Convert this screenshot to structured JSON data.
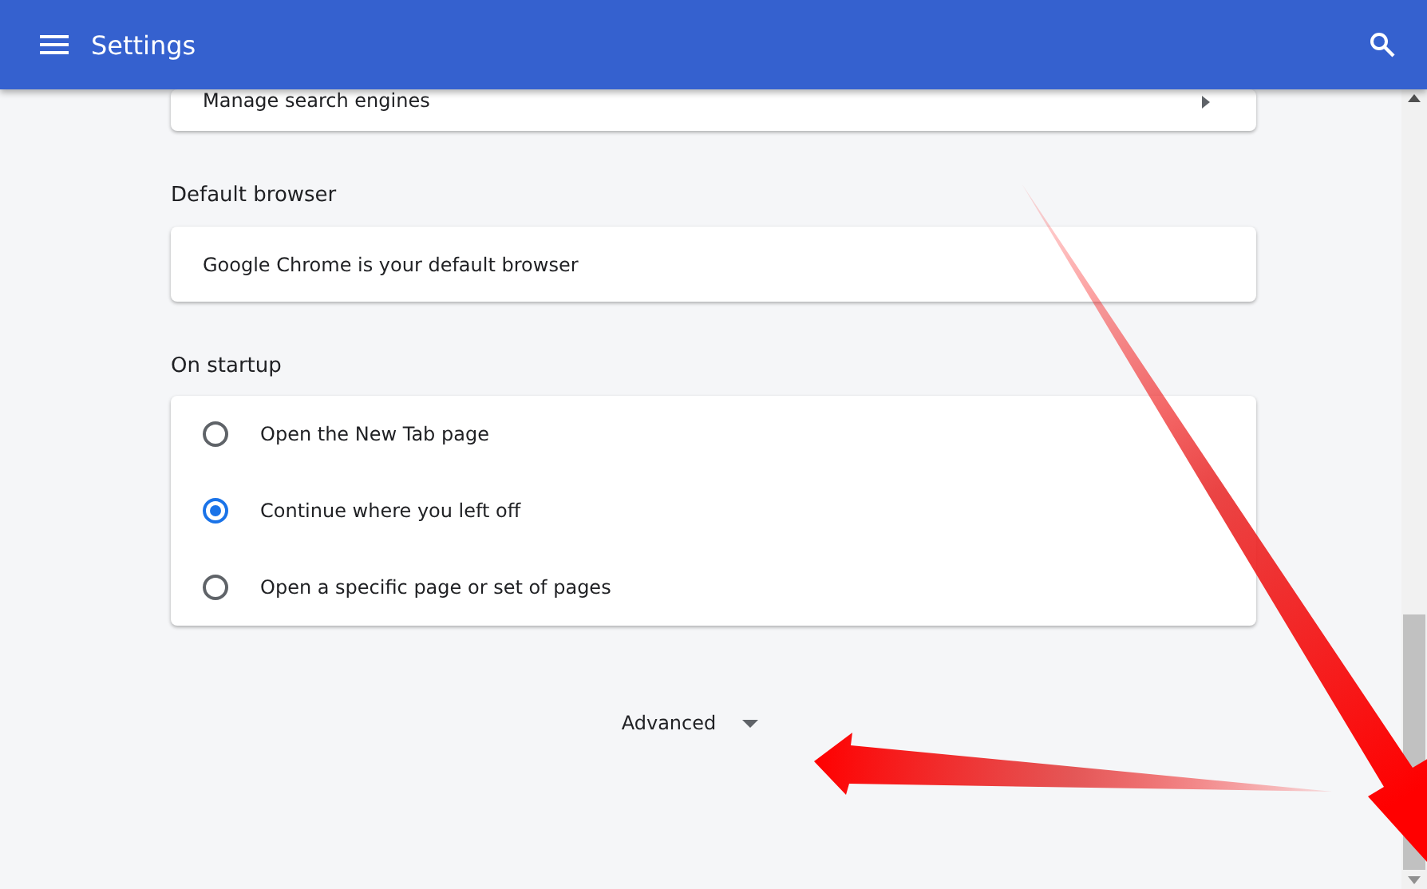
{
  "header": {
    "title": "Settings"
  },
  "search_engines": {
    "label": "Manage search engines"
  },
  "default_browser": {
    "heading": "Default browser",
    "status": "Google Chrome is your default browser"
  },
  "on_startup": {
    "heading": "On startup",
    "options": [
      {
        "label": "Open the New Tab page",
        "selected": false
      },
      {
        "label": "Continue where you left off",
        "selected": true
      },
      {
        "label": "Open a specific page or set of pages",
        "selected": false
      }
    ]
  },
  "advanced": {
    "label": "Advanced",
    "expanded": false
  }
}
